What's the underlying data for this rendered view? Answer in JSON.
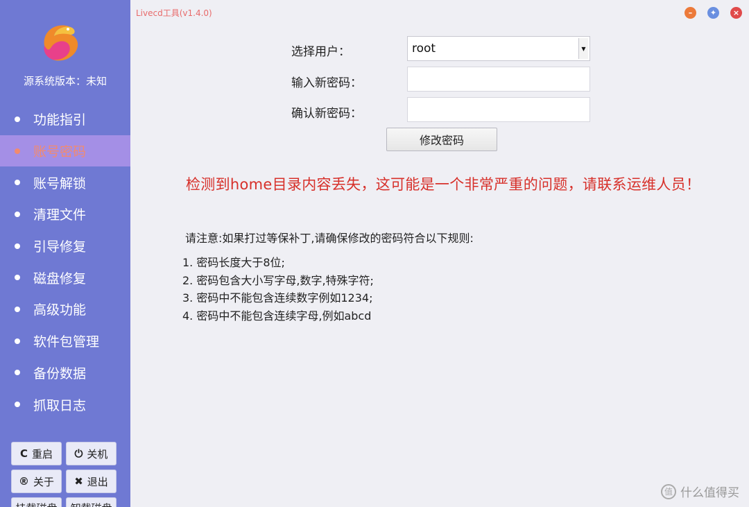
{
  "app": {
    "title": "Livecd工具(v1.4.0)",
    "version_label": "源系统版本：未知"
  },
  "sidebar": {
    "items": [
      {
        "label": "功能指引"
      },
      {
        "label": "账号密码",
        "active": true
      },
      {
        "label": "账号解锁"
      },
      {
        "label": "清理文件"
      },
      {
        "label": "引导修复"
      },
      {
        "label": "磁盘修复"
      },
      {
        "label": "高级功能"
      },
      {
        "label": "软件包管理"
      },
      {
        "label": "备份数据"
      },
      {
        "label": "抓取日志"
      }
    ],
    "system_buttons": [
      {
        "icon": "C",
        "label": "重启"
      },
      {
        "icon": "⏻",
        "label": "关机"
      },
      {
        "icon": "®",
        "label": "关于"
      },
      {
        "icon": "✖",
        "label": "退出"
      },
      {
        "icon": "",
        "label": "挂载磁盘"
      },
      {
        "icon": "",
        "label": "卸载磁盘"
      }
    ]
  },
  "form": {
    "user_label": "选择用户：",
    "user_value": "root",
    "new_password_label": "输入新密码：",
    "new_password_value": "",
    "confirm_password_label": "确认新密码：",
    "confirm_password_value": "",
    "submit_label": "修改密码"
  },
  "warning": "检测到home目录内容丢失，这可能是一个非常严重的问题，请联系运维人员！",
  "notes": {
    "intro": "请注意:如果打过等保补丁,请确保修改的密码符合以下规则:",
    "rules": [
      "1. 密码长度大于8位;",
      "2. 密码包含大小写字母,数字,特殊字符;",
      "3. 密码中不能包含连续数字例如1234;",
      "4. 密码中不能包含连续字母,例如abcd"
    ]
  },
  "watermark": {
    "badge": "值",
    "text": "什么值得买"
  },
  "colors": {
    "sidebar_bg": "#6f79d3",
    "active_item_bg": "#a48fe6",
    "warning_text": "#d7302a",
    "title_text": "#e86a6a"
  }
}
